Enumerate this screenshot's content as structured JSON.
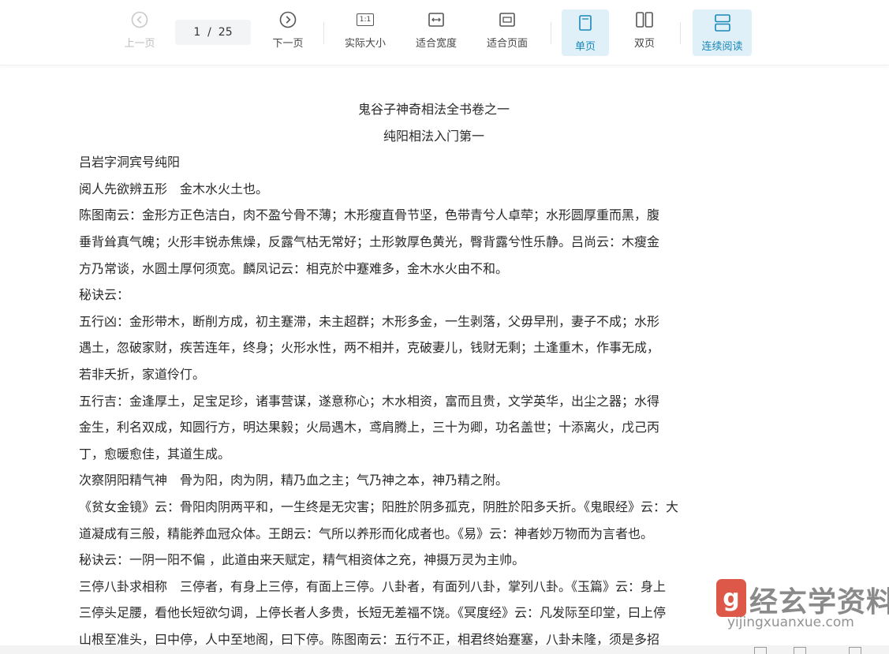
{
  "toolbar": {
    "prev_label": "上一页",
    "page_indicator": "1  /  25",
    "next_label": "下一页",
    "actual_size_label": "实际大小",
    "actual_size_glyph": "1:1",
    "fit_width_label": "适合宽度",
    "fit_page_label": "适合页面",
    "single_page_label": "单页",
    "double_page_label": "双页",
    "continuous_label": "连续阅读",
    "accent_color": "#1a87b8",
    "active_bg": "#dff0f8"
  },
  "document": {
    "title": "鬼谷子神奇相法全书卷之一",
    "subtitle": "纯阳相法入门第一",
    "lines": [
      "吕岩字洞宾号纯阳",
      "阅人先欲辨五形　金木水火土也。",
      "陈图南云：金形方正色洁白，肉不盈兮骨不薄；木形瘦直骨节坚，色带青兮人卓荦；水形圆厚重而黑，腹",
      "垂背耸真气魄；火形丰锐赤焦燥，反露气枯无常好；土形敦厚色黄光，臀背露兮性乐静。吕尚云：木瘦金",
      "方乃常谈，水圆土厚何须宽。麟凤记云：相克於中蹇难多，金木水火由不和。",
      "秘诀云：",
      "五行凶：金形带木，断削方成，初主蹇滞，未主超群；木形多金，一生剥落，父毋早刑，妻子不成；水形",
      "遇土，忽破家财，疾苦连年，终身；火形水性，两不相并，克破妻儿，钱财无剩；土逢重木，作事无成，",
      "若非夭折，家道伶仃。",
      "五行吉：金逢厚土，足宝足珍，诸事营谋，遂意称心；木水相资，富而且贵，文学英华，出尘之器；水得",
      "金生，利名双成，知圆行方，明达果毅；火局遇木，鸢肩腾上，三十为卿，功名盖世；十添离火，戊己丙",
      "丁，愈暖愈佳，其道生成。",
      "次察阴阳精气神　骨为阳，肉为阴，精乃血之主；气乃神之本，神乃精之附。",
      "《贫女金镜》云：骨阳肉阴两平和，一生终是无灾害；阳胜於阴多孤克，阴胜於阳多夭折。《鬼眼经》云：大",
      "道凝成有三般，精能养血冠众体。王朗云：气所以养形而化成者也。《易》云：神者妙万物而为言者也。",
      "秘诀云：一阴一阳不偏 ，此道由来天赋定，精气相资体之充，神摄万灵为主帅。",
      "三停八卦求相称　三停者，有身上三停，有面上三停。八卦者，有面列八卦，掌列八卦。《玉篇》云：身上",
      "三停头足腰，看他长短欲匀调，上停长者人多贵，长短无差福不饶。《冥度经》云：凡发际至印堂，曰上停",
      "山根至准头，曰中停，人中至地阁，曰下停。陈图南云：五行不正，相君终始蹇塞，八卦未隆，须是多招"
    ]
  },
  "watermark": {
    "logo_char": "g",
    "site_name_cn": "经玄学资料网",
    "site_url": "yijingxuanxue.com"
  }
}
